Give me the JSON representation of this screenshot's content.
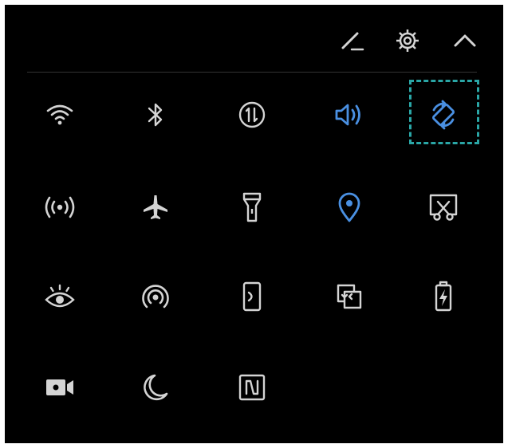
{
  "colors": {
    "panel_background": "#000000",
    "icon_inactive": "#d4d4d4",
    "icon_active": "#4a90e2",
    "highlight_border": "#2aa6a6",
    "divider": "#333333"
  },
  "header": {
    "icons": [
      "edit-icon",
      "settings-gear-icon",
      "collapse-chevron-up-icon"
    ]
  },
  "tiles": [
    {
      "icon": "wifi-icon",
      "active": false
    },
    {
      "icon": "bluetooth-icon",
      "active": false
    },
    {
      "icon": "mobile-data-icon",
      "active": false
    },
    {
      "icon": "sound-icon",
      "active": true
    },
    {
      "icon": "auto-rotate-icon",
      "active": true,
      "highlighted": true
    },
    {
      "icon": "hotspot-icon",
      "active": false
    },
    {
      "icon": "airplane-mode-icon",
      "active": false
    },
    {
      "icon": "flashlight-icon",
      "active": false
    },
    {
      "icon": "location-icon",
      "active": true
    },
    {
      "icon": "screenshot-icon",
      "active": false
    },
    {
      "icon": "eye-comfort-icon",
      "active": false
    },
    {
      "icon": "wireless-projection-icon",
      "active": false
    },
    {
      "icon": "phone-clone-icon",
      "active": false
    },
    {
      "icon": "huawei-share-icon",
      "active": false
    },
    {
      "icon": "power-saving-icon",
      "active": false
    },
    {
      "icon": "screen-recorder-icon",
      "active": false
    },
    {
      "icon": "do-not-disturb-icon",
      "active": false
    },
    {
      "icon": "nfc-icon",
      "active": false
    }
  ]
}
